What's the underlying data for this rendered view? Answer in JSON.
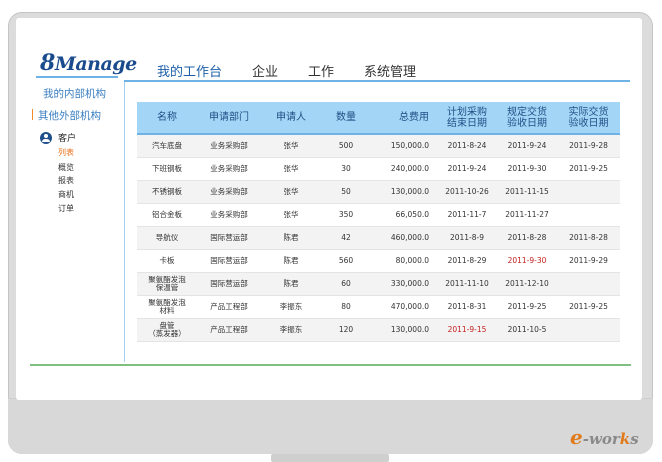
{
  "brand": {
    "logo_num": "8",
    "logo_text": "Manage"
  },
  "nav": [
    {
      "label": "我的工作台"
    },
    {
      "label": "企业"
    },
    {
      "label": "工作"
    },
    {
      "label": "系统管理"
    }
  ],
  "sidebar": {
    "internal": "我的内部机构",
    "external": "其他外部机构",
    "customer": "客户",
    "items": [
      {
        "label": "列表"
      },
      {
        "label": "概览"
      },
      {
        "label": "报表"
      },
      {
        "label": "商机"
      },
      {
        "label": "订单"
      }
    ]
  },
  "table": {
    "headers": [
      "名称",
      "申请部门",
      "申请人",
      "数量",
      "总费用",
      "计划采购\n结束日期",
      "规定交货\n验收日期",
      "实际交货\n验收日期"
    ],
    "rows": [
      [
        "汽车底盘",
        "业务采购部",
        "张华",
        "500",
        "150,000.0",
        "2011-8-24",
        "2011-9-24",
        "2011-9-28"
      ],
      [
        "下班钢板",
        "业务采购部",
        "张华",
        "30",
        "240,000.0",
        "2011-9-24",
        "2011-9-30",
        "2011-9-25"
      ],
      [
        "不锈钢板",
        "业务采购部",
        "张华",
        "50",
        "130,000.0",
        "2011-10-26",
        "2011-11-15",
        ""
      ],
      [
        "铝合金板",
        "业务采购部",
        "张华",
        "350",
        "66,050.0",
        "2011-11-7",
        "2011-11-27",
        ""
      ],
      [
        "导航仪",
        "国际营运部",
        "陈君",
        "42",
        "460,000.0",
        "2011-8-9",
        "2011-8-28",
        "2011-8-28"
      ],
      [
        "卡板",
        "国际营运部",
        "陈君",
        "560",
        "80,000.0",
        "2011-8-29",
        "2011-9-30",
        "2011-9-29"
      ],
      [
        "聚氨酯发泡\n保温管",
        "国际营运部",
        "陈君",
        "60",
        "330,000.0",
        "2011-11-10",
        "2011-12-10",
        ""
      ],
      [
        "聚氨酯发泡\n材料",
        "产品工程部",
        "李振东",
        "80",
        "470,000.0",
        "2011-8-31",
        "2011-9-25",
        "2011-9-25"
      ],
      [
        "盘管\n（蒸发器）",
        "产品工程部",
        "李振东",
        "120",
        "130,000.0",
        "2011-9-15",
        "2011-10-5",
        ""
      ]
    ]
  },
  "watermark": {
    "e": "e",
    "wor": "-wor",
    "k": "k",
    "s": "s"
  },
  "colors": {
    "accent": "#1e5fa8",
    "header_bg": "#a3d6f6",
    "overdue": "#c41e1e",
    "active_sub": "#e8701a"
  }
}
